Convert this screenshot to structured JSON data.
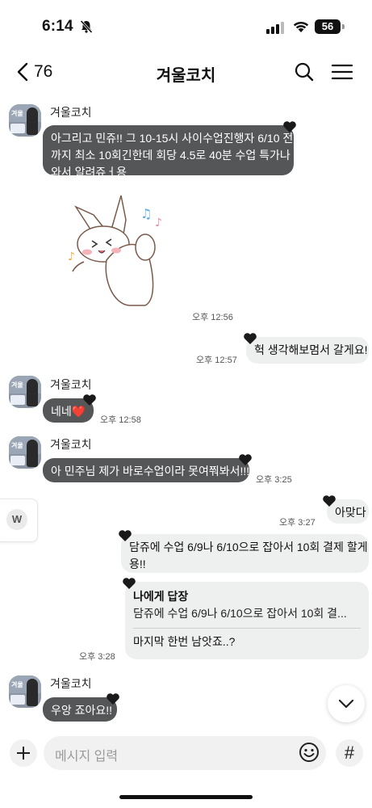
{
  "status_bar": {
    "time": "6:14",
    "battery": "56",
    "icons": [
      "bell-slash-icon",
      "signal-icon",
      "wifi-icon",
      "battery-icon"
    ]
  },
  "header": {
    "back_count": "76",
    "title": "겨울코치",
    "icons": [
      "chevron-left-icon",
      "search-icon",
      "hamburger-menu-icon"
    ]
  },
  "messages": [
    {
      "sender": "겨울코치",
      "line1": "아그리고 민쥬!! 그 10-15시 사이수업진행자 6/10 전",
      "line2": "까지 최소 10회긴한데 회당 4.5로 40분 수업 특가나",
      "line3": "와서 알려쥬ㅓ용"
    },
    {
      "sticker": "dancing-bunny-sticker",
      "time": "오후 12:56"
    },
    {
      "text": "헉 생각해보멈서 갈게요!",
      "time": "오후 12:57"
    },
    {
      "sender": "겨울코치",
      "text": "네네❤️",
      "time": "오후 12:58"
    },
    {
      "sender": "겨울코치",
      "text": "아 민주님 제가 바로수업이라 못여쭤봐서!!!",
      "time": "오후 3:25"
    },
    {
      "text": "아맞다",
      "time": "오후 3:27"
    },
    {
      "line1": "담쥬에 수업 6/9나 6/10으로 잡아서 10회 결제 할게",
      "line2": "용!!"
    },
    {
      "reply_label": "나에게 답장",
      "reply_quote": "담쥬에 수업 6/9나 6/10으로 잡아서 10회 결...",
      "text": "마지막 한번 남앗죠..?",
      "time": "오후 3:28"
    },
    {
      "sender": "겨울코치",
      "text": "우앙 죠아요!!"
    }
  ],
  "side_tab": {
    "label": "W"
  },
  "input": {
    "placeholder": "메시지 입력",
    "hash": "#"
  },
  "avatar_text": "겨울",
  "colors": {
    "dark_bubble": "#555657",
    "light_bubble": "#eeefef",
    "heart": "#1a1a1a"
  }
}
